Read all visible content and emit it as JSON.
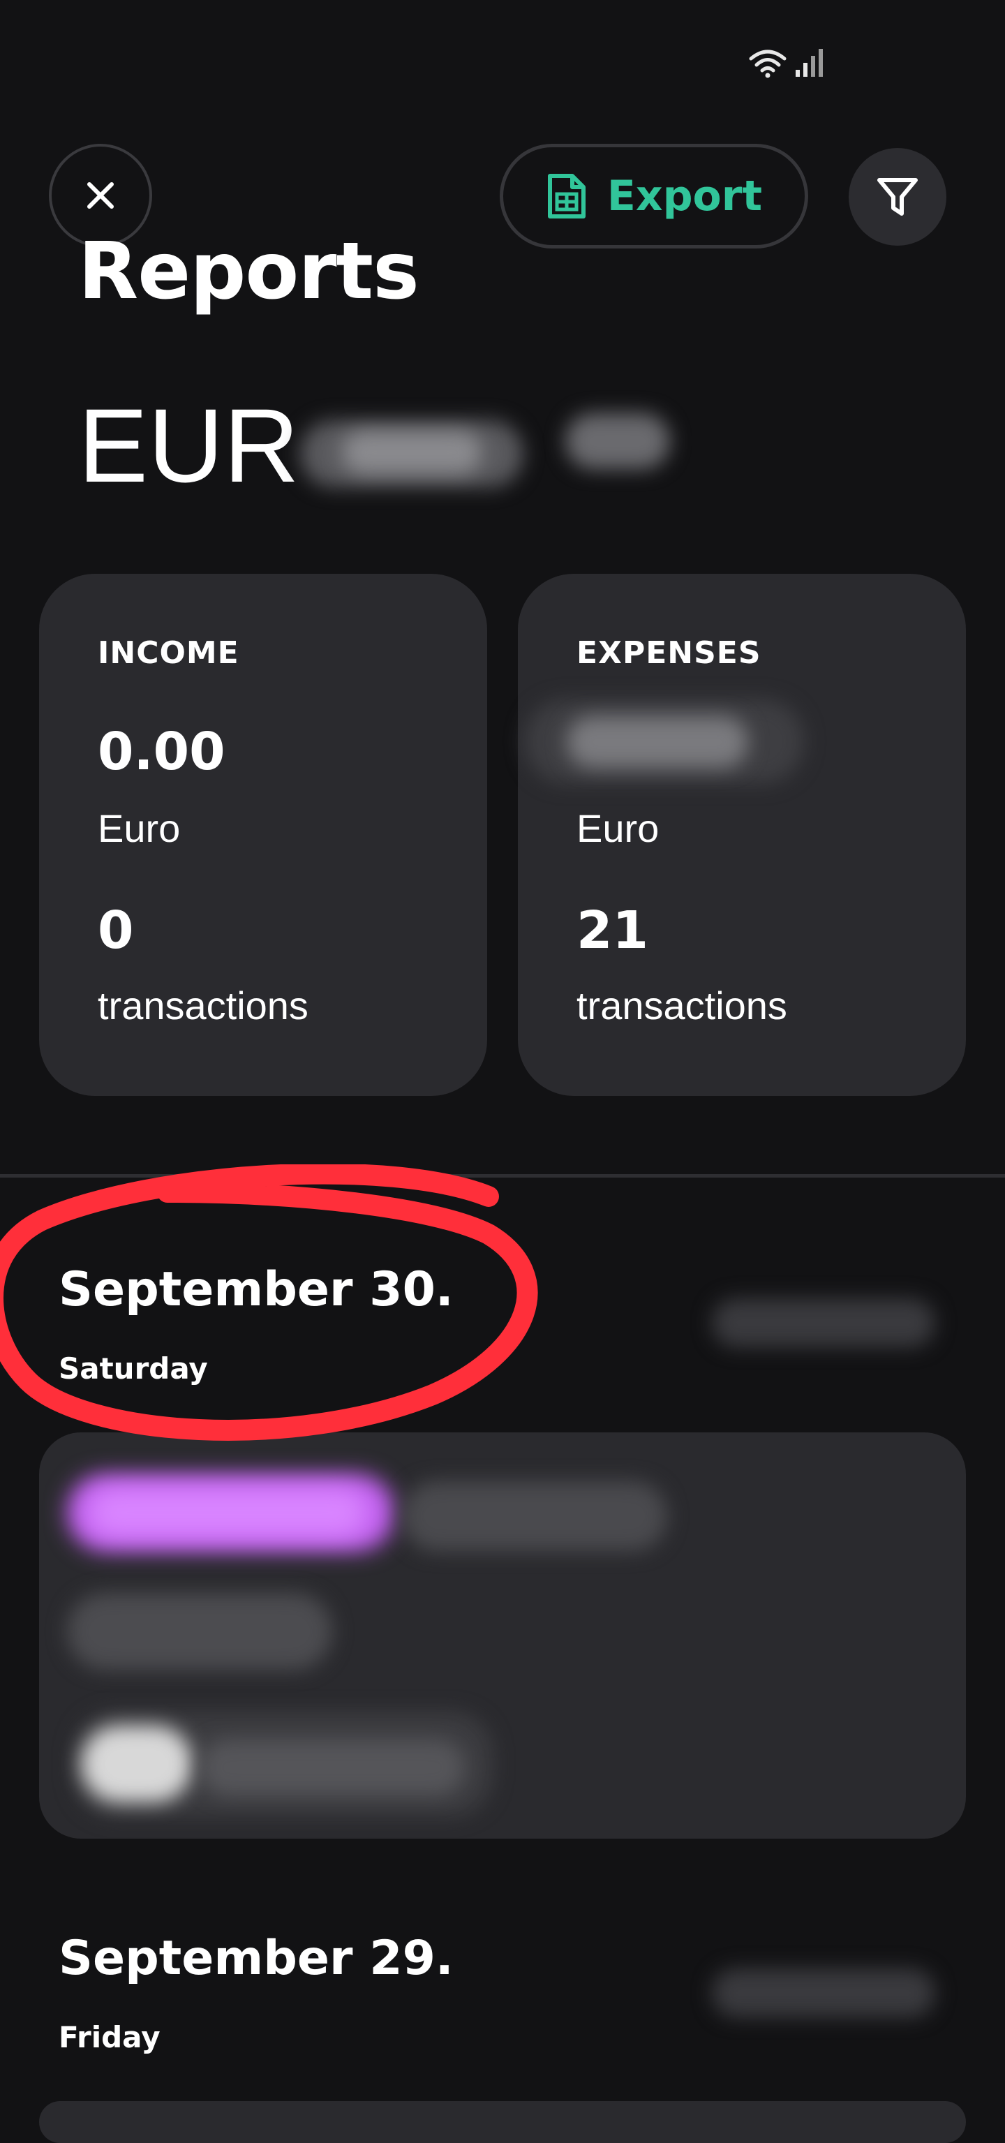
{
  "status_bar": {
    "icons": [
      "wifi-icon",
      "signal-icon"
    ]
  },
  "header": {
    "close_icon": "close-icon",
    "export_label": "Export",
    "export_icon": "spreadsheet-icon",
    "filter_icon": "filter-icon"
  },
  "page": {
    "title": "Reports",
    "currency": "EUR"
  },
  "summary": {
    "income": {
      "heading": "INCOME",
      "amount": "0.00",
      "unit": "Euro",
      "count": "0",
      "count_label": "transactions"
    },
    "expenses": {
      "heading": "EXPENSES",
      "unit": "Euro",
      "count": "21",
      "count_label": "transactions"
    }
  },
  "days": [
    {
      "title": "September 30.",
      "weekday": "Saturday"
    },
    {
      "title": "September 29.",
      "weekday": "Friday"
    }
  ],
  "colors": {
    "background": "#121214",
    "card": "#2a2a2e",
    "accent": "#31c59a",
    "annotation": "#ff2f3a",
    "tag_purple": "#c260f0"
  }
}
